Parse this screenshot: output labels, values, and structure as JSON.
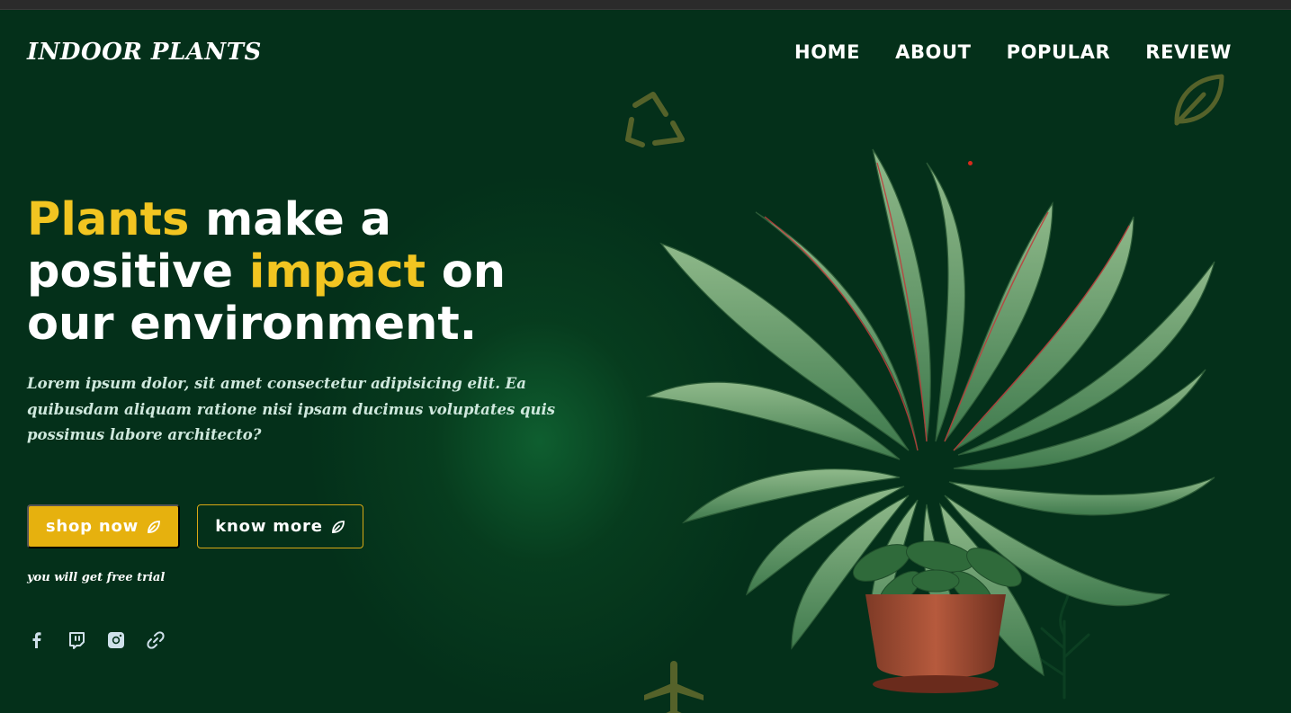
{
  "brand": {
    "logo": "INDOOR PLANTS"
  },
  "nav": {
    "items": [
      {
        "label": "HOME"
      },
      {
        "label": "ABOUT"
      },
      {
        "label": "POPULAR"
      },
      {
        "label": "REVIEW"
      }
    ]
  },
  "hero": {
    "headline": {
      "part1": "Plants",
      "part2": " make a positive ",
      "part3": "impact",
      "part4": " on our environment."
    },
    "description": "Lorem ipsum dolor, sit amet consectetur adipisicing elit. Ea quibusdam aliquam ratione nisi ipsam ducimus voluptates quis possimus labore architecto?",
    "buttons": {
      "shop_label": "shop now",
      "know_label": "know more"
    },
    "trial_note": "you will get free trial"
  },
  "social": {
    "icons": [
      "facebook-icon",
      "twitch-icon",
      "instagram-icon",
      "link-icon"
    ]
  },
  "colors": {
    "background": "#04301a",
    "accent": "#f2c521",
    "button": "#e6b10e",
    "deco": "#55622a"
  }
}
